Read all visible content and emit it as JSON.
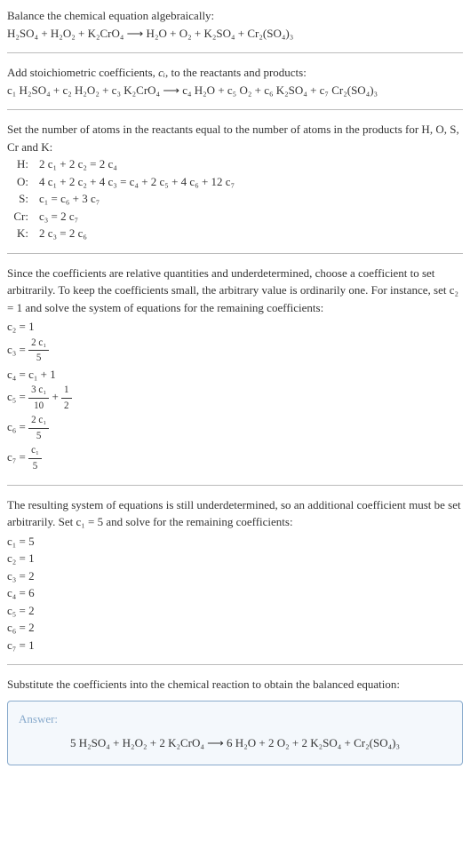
{
  "instr1": "Balance the chemical equation algebraically:",
  "eq1": "H₂SO₄ + H₂O₂ + K₂CrO₄  ⟶  H₂O + O₂ + K₂SO₄ + Cr₂(SO₄)₃",
  "instr2a": "Add stoichiometric coefficients, ",
  "instr2b": ", to the reactants and products:",
  "ci_html": "cᵢ",
  "eq2": "c₁ H₂SO₄ + c₂ H₂O₂ + c₃ K₂CrO₄  ⟶  c₄ H₂O + c₅ O₂ + c₆ K₂SO₄ + c₇ Cr₂(SO₄)₃",
  "instr3": "Set the number of atoms in the reactants equal to the number of atoms in the products for H, O, S, Cr and K:",
  "balance_rows": [
    {
      "el": "H:",
      "eq": "2 c₁ + 2 c₂ = 2 c₄"
    },
    {
      "el": "O:",
      "eq": "4 c₁ + 2 c₂ + 4 c₃ = c₄ + 2 c₅ + 4 c₆ + 12 c₇"
    },
    {
      "el": "S:",
      "eq": "c₁ = c₆ + 3 c₇"
    },
    {
      "el": "Cr:",
      "eq": "c₃ = 2 c₇"
    },
    {
      "el": "K:",
      "eq": "2 c₃ = 2 c₆"
    }
  ],
  "instr4": "Since the coefficients are relative quantities and underdetermined, choose a coefficient to set arbitrarily. To keep the coefficients small, the arbitrary value is ordinarily one. For instance, set c₂ = 1 and solve the system of equations for the remaining coefficients:",
  "sol1": {
    "c2": "c₂ = 1",
    "c3_lhs": "c₃ = ",
    "c3_num": "2 c₁",
    "c3_den": "5",
    "c4": "c₄ = c₁ + 1",
    "c5_lhs": "c₅ = ",
    "c5_num1": "3 c₁",
    "c5_den1": "10",
    "c5_plus": " + ",
    "c5_num2": "1",
    "c5_den2": "2",
    "c6_lhs": "c₆ = ",
    "c6_num": "2 c₁",
    "c6_den": "5",
    "c7_lhs": "c₇ = ",
    "c7_num": "c₁",
    "c7_den": "5"
  },
  "instr5": "The resulting system of equations is still underdetermined, so an additional coefficient must be set arbitrarily. Set c₁ = 5 and solve for the remaining coefficients:",
  "sol2": [
    "c₁ = 5",
    "c₂ = 1",
    "c₃ = 2",
    "c₄ = 6",
    "c₅ = 2",
    "c₆ = 2",
    "c₇ = 1"
  ],
  "instr6": "Substitute the coefficients into the chemical reaction to obtain the balanced equation:",
  "answer_label": "Answer:",
  "answer_eq": "5 H₂SO₄ + H₂O₂ + 2 K₂CrO₄  ⟶  6 H₂O + 2 O₂ + 2 K₂SO₄ + Cr₂(SO₄)₃"
}
